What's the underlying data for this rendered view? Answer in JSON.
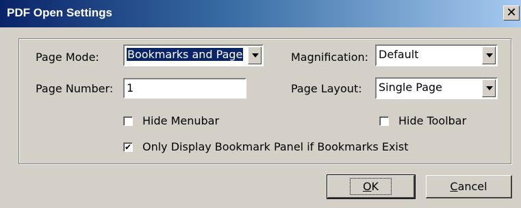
{
  "window": {
    "title": "PDF Open Settings",
    "close_glyph": "✕"
  },
  "fields": {
    "page_mode_label": "Page Mode:",
    "page_mode_value": "Bookmarks and Page",
    "magnification_label": "Magnification:",
    "magnification_value": "Default",
    "page_number_label": "Page Number:",
    "page_number_value": "1",
    "page_layout_label": "Page Layout:",
    "page_layout_value": "Single Page"
  },
  "checkboxes": {
    "hide_menubar": {
      "label": "Hide Menubar",
      "checked": false
    },
    "hide_toolbar": {
      "label": "Hide Toolbar",
      "checked": false
    },
    "only_bookmarks": {
      "label": "Only Display Bookmark Panel if Bookmarks Exist",
      "checked": true,
      "mark": "✔"
    }
  },
  "buttons": {
    "ok_mnemonic": "O",
    "ok_rest": "K",
    "cancel_mnemonic": "C",
    "cancel_rest": "ancel"
  }
}
